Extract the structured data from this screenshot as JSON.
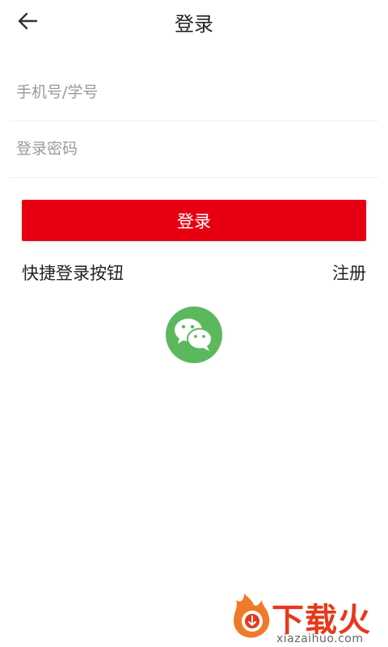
{
  "header": {
    "title": "登录",
    "back_icon": "arrow-left-icon"
  },
  "form": {
    "account_placeholder": "手机号/学号",
    "account_value": "",
    "password_placeholder": "登录密码",
    "password_value": "",
    "login_label": "登录"
  },
  "quick_login": {
    "label": "快捷登录按钮",
    "register_label": "注册",
    "wechat_icon": "wechat-icon"
  },
  "watermark": {
    "brand": "下载火",
    "url": "xiazaihuo.com"
  },
  "colors": {
    "primary": "#e60012",
    "wechat": "#5cb85c",
    "watermark": "#e8381b"
  }
}
